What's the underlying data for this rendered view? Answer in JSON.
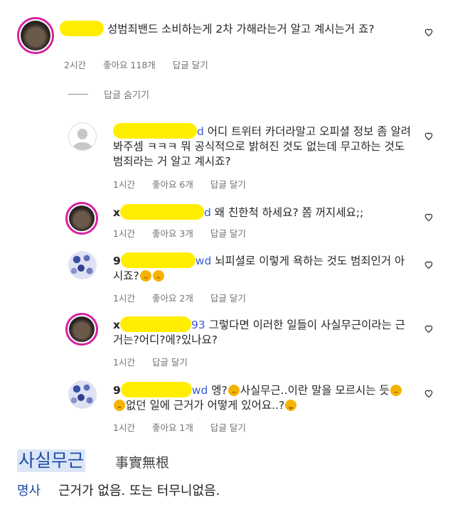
{
  "comments": [
    {
      "mention": "",
      "text": "성범죄밴드 소비하는게 2차 가해라는거 알고 계시는거 죠?",
      "time": "2시간",
      "likes": "좋아요 118개",
      "reply": "답글 달기"
    },
    {
      "mention": "d",
      "text": "어디 트위터 카더라말고 오피셜 정보 좀 알려봐주셈 ㅋㅋㅋ 뭐 공식적으로 밝혀진 것도 없는데 무고하는 것도 범죄라는 거 알고 계시죠?",
      "time": "1시간",
      "likes": "좋아요 6개",
      "reply": "답글 달기"
    },
    {
      "username": "x",
      "mention": "d",
      "text": "왜 친한척 하세요? 쫌 꺼지세요;;",
      "time": "1시간",
      "likes": "좋아요 3개",
      "reply": "답글 달기"
    },
    {
      "username": "9",
      "mention": "wd",
      "text": "뇌피셜로 이렇게 욕하는 것도 범죄인거 아시죠?",
      "time": "1시간",
      "likes": "좋아요 2개",
      "reply": "답글 달기"
    },
    {
      "username": "x",
      "mention": "93",
      "text": "그렇다면 이러한 일들이 사실무근이라는 근거는?어디?에?있나요?",
      "time": "1시간",
      "reply": "답글 달기"
    },
    {
      "username": "9",
      "mention": "wd",
      "text_a": "엥?",
      "text_b": "사실무근..이란 말을 모르시는 듯",
      "text_c": "없던 일에 근거가 어떻게 있어요..?",
      "time": "1시간",
      "likes": "좋아요 1개",
      "reply": "답글 달기"
    }
  ],
  "hide_replies": "답글 숨기기",
  "dictionary": {
    "word": "사실무근",
    "hanja": "事實無根",
    "pos": "명사",
    "definition": "근거가 없음. 또는 터무니없음."
  },
  "colors": {
    "highlight": "#ffee00",
    "meta": "#737373",
    "dict_blue": "#1d4aa8"
  }
}
